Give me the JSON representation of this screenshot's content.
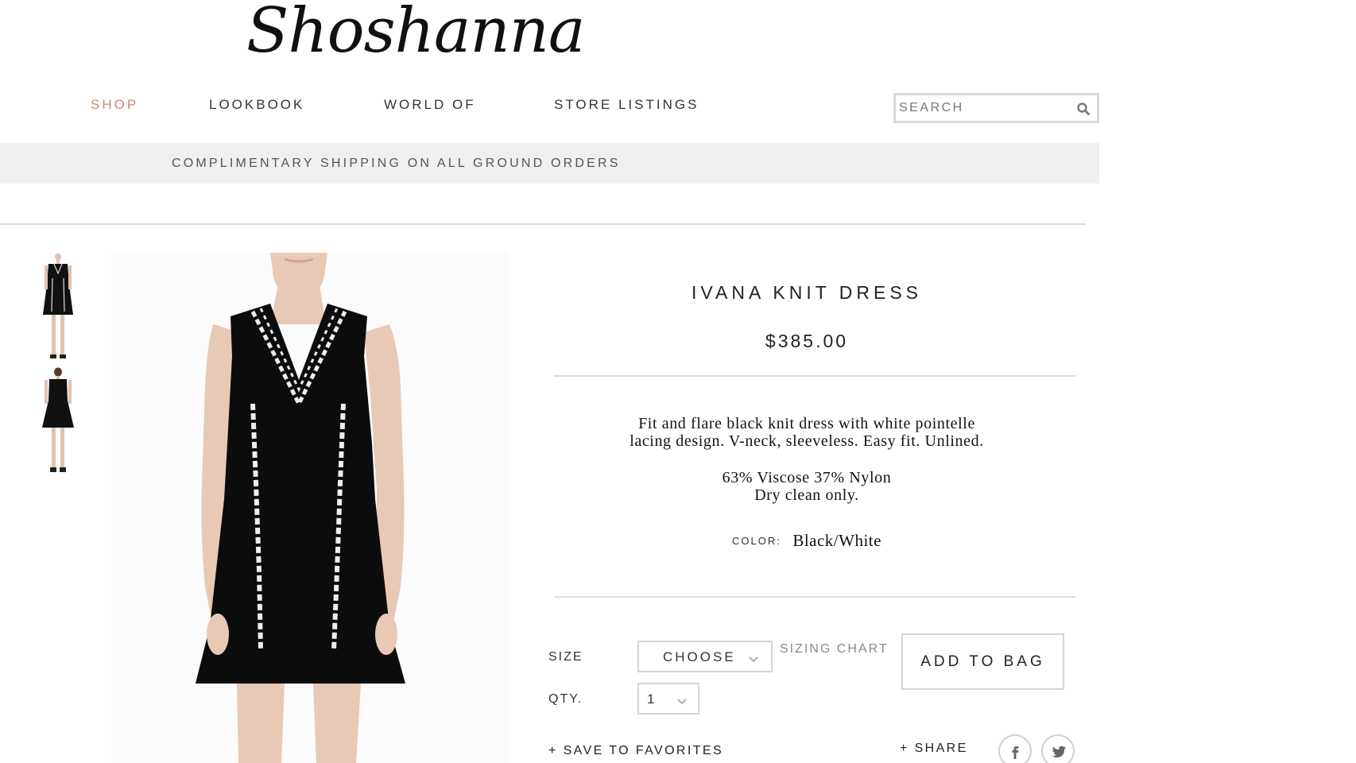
{
  "brand": {
    "logo_text": "Shoshanna"
  },
  "nav": {
    "items": [
      {
        "label": "SHOP",
        "active": true
      },
      {
        "label": "LOOKBOOK"
      },
      {
        "label": "WORLD OF"
      },
      {
        "label": "STORE LISTINGS"
      }
    ],
    "active_color": "#c9897a"
  },
  "search": {
    "placeholder": "SEARCH",
    "icon": "search-icon"
  },
  "promo": {
    "text": "COMPLIMENTARY SHIPPING ON ALL GROUND ORDERS"
  },
  "product": {
    "title": "IVANA KNIT DRESS",
    "price": "$385.00",
    "description_line1": "Fit and flare black knit dress with white pointelle",
    "description_line2": "lacing design. V-neck, sleeveless. Easy fit. Unlined.",
    "composition": "63% Viscose 37% Nylon",
    "care": "Dry clean only.",
    "color_label": "COLOR:",
    "color_value": "Black/White",
    "thumbnails": [
      "front-view",
      "back-view"
    ]
  },
  "purchase": {
    "size_label": "SIZE",
    "size_value": "CHOOSE",
    "qty_label": "QTY.",
    "qty_value": "1",
    "sizing_chart": "SIZING CHART",
    "add_to_bag": "ADD TO BAG",
    "save_to_favorites": "+ SAVE TO FAVORITES",
    "share": "+ SHARE",
    "social": [
      "facebook-icon",
      "twitter-icon"
    ]
  }
}
